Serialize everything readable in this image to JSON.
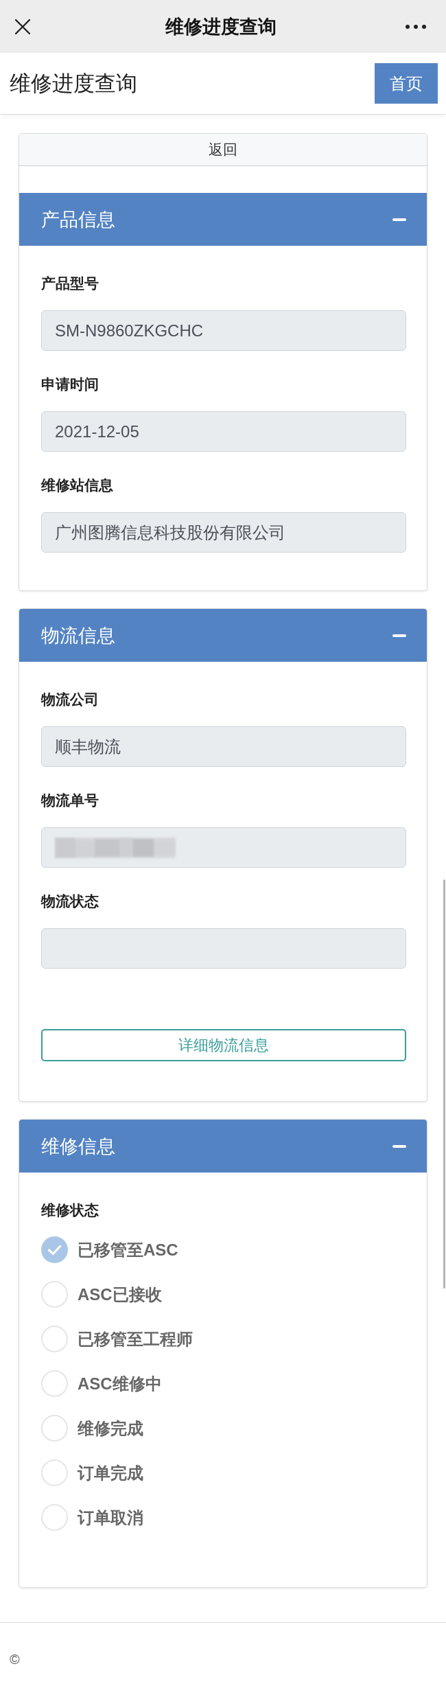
{
  "top_bar": {
    "title": "维修进度查询"
  },
  "header": {
    "title": "维修进度查询",
    "home_button": "首页"
  },
  "back_button": "返回",
  "sections": [
    {
      "kind": "fields",
      "title": "产品信息",
      "expanded": true,
      "fields": [
        {
          "label": "产品型号",
          "value": "SM-N9860ZKGCHC",
          "redacted": false
        },
        {
          "label": "申请时间",
          "value": "2021-12-05",
          "redacted": false
        },
        {
          "label": "维修站信息",
          "value": "广州图腾信息科技股份有限公司",
          "redacted": false
        }
      ]
    },
    {
      "kind": "fields",
      "title": "物流信息",
      "expanded": true,
      "fields": [
        {
          "label": "物流公司",
          "value": "顺丰物流",
          "redacted": false
        },
        {
          "label": "物流单号",
          "redacted": true
        },
        {
          "label": "物流状态",
          "redacted": false
        }
      ],
      "button": "详细物流信息"
    },
    {
      "kind": "radios",
      "title": "维修信息",
      "expanded": true,
      "group_label": "维修状态",
      "options": [
        {
          "label": "已移管至ASC",
          "selected": true
        },
        {
          "label": "ASC已接收",
          "selected": false
        },
        {
          "label": "已移管至工程师",
          "selected": false
        },
        {
          "label": "ASC维修中",
          "selected": false
        },
        {
          "label": "维修完成",
          "selected": false
        },
        {
          "label": "订单完成",
          "selected": false
        },
        {
          "label": "订单取消",
          "selected": false
        }
      ]
    }
  ],
  "footer": {
    "text": "©"
  }
}
